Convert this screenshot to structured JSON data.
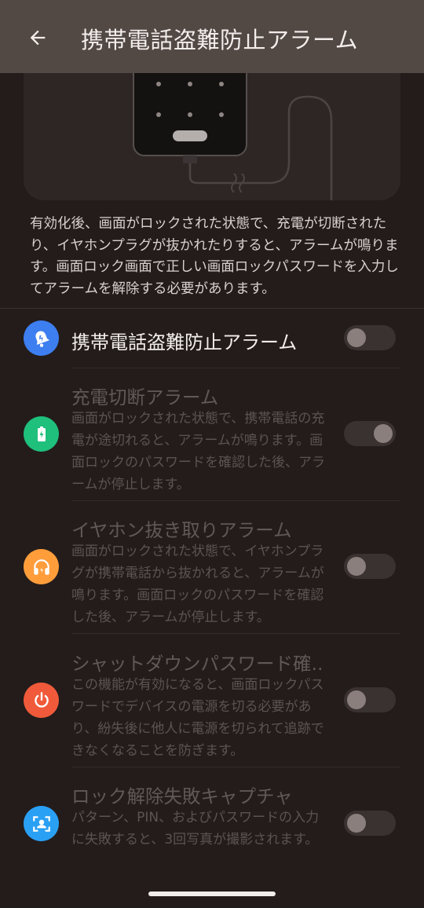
{
  "header": {
    "title": "携帯電話盗難防止アラーム",
    "back_icon": "arrow-left-icon"
  },
  "description": "有効化後、画面がロックされた状態で、充電が切断されたり、イヤホンプラグが抜かれたりすると、アラームが鳴ります。画面ロック画面で正しい画面ロックパスワードを入力してアラームを解除する必要があります。",
  "main": {
    "title": "携帯電話盗難防止アラーム",
    "icon": "bell-alarm-icon",
    "icon_color": "#3d7ef0",
    "enabled": false
  },
  "items": [
    {
      "title": "充電切断アラーム",
      "description": "画面がロックされた状態で、携帯電話の充電が途切れると、アラームが鳴ります。画面ロックのパスワードを確認した後、アラームが停止します。",
      "icon": "battery-charging-icon",
      "icon_color": "#1fbf7c",
      "enabled": true
    },
    {
      "title": "イヤホン抜き取りアラーム",
      "description": "画面がロックされた状態で、イヤホンプラグが携帯電話から抜かれると、アラームが鳴ります。画面ロックのパスワードを確認した後、アラームが停止します。",
      "icon": "headphones-icon",
      "icon_color": "#ff9d3b",
      "enabled": false
    },
    {
      "title": "シャットダウンパスワード確..",
      "description": "この機能が有効になると、画面ロックパスワードでデバイスの電源を切る必要があり、紛失後に他人に電源を切られて追跡できなくなることを防ぎます。",
      "icon": "power-icon",
      "icon_color": "#f05a3a",
      "enabled": false
    },
    {
      "title": "ロック解除失敗キャプチャ",
      "description": "パターン、PIN、およびパスワードの入力に失敗すると、3回写真が撮影されます。",
      "icon": "face-scan-icon",
      "icon_color": "#2aa0f5",
      "enabled": false
    }
  ]
}
